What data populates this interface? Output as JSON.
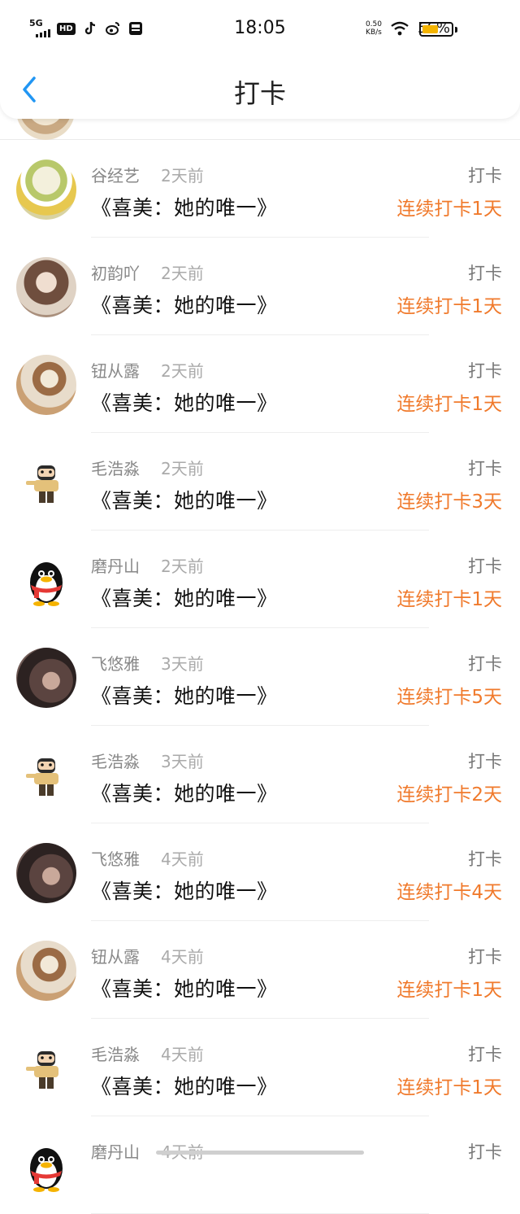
{
  "status_bar": {
    "network": "5G",
    "hd": "HD",
    "time": "18:05",
    "net_speed_value": "0.50",
    "net_speed_unit": "KB/s",
    "battery": "56%",
    "battery_level": 0.56,
    "icons": [
      "signal-icon",
      "tiktok-icon",
      "weibo-icon",
      "app-icon",
      "wifi-icon",
      "battery-icon"
    ]
  },
  "nav": {
    "title": "打卡",
    "back_icon": "chevron-left-icon"
  },
  "colors": {
    "accent_blue": "#2196f3",
    "streak_orange": "#f07a2c"
  },
  "items": [
    {
      "name": "谷经艺",
      "time": "2天前",
      "action": "打卡",
      "book": "《喜美：她的唯一》",
      "streak": "连续打卡1天",
      "avatar": "cupcake"
    },
    {
      "name": "初韵吖",
      "time": "2天前",
      "action": "打卡",
      "book": "《喜美：她的唯一》",
      "streak": "连续打卡1天",
      "avatar": "girl"
    },
    {
      "name": "钮从露",
      "time": "2天前",
      "action": "打卡",
      "book": "《喜美：她的唯一》",
      "streak": "连续打卡1天",
      "avatar": "warrior"
    },
    {
      "name": "毛浩淼",
      "time": "2天前",
      "action": "打卡",
      "book": "《喜美：她的唯一》",
      "streak": "连续打卡3天",
      "avatar": "cartoon"
    },
    {
      "name": "磨丹山",
      "time": "2天前",
      "action": "打卡",
      "book": "《喜美：她的唯一》",
      "streak": "连续打卡1天",
      "avatar": "penguin"
    },
    {
      "name": "飞悠雅",
      "time": "3天前",
      "action": "打卡",
      "book": "《喜美：她的唯一》",
      "streak": "连续打卡5天",
      "avatar": "dark"
    },
    {
      "name": "毛浩淼",
      "time": "3天前",
      "action": "打卡",
      "book": "《喜美：她的唯一》",
      "streak": "连续打卡2天",
      "avatar": "cartoon"
    },
    {
      "name": "飞悠雅",
      "time": "4天前",
      "action": "打卡",
      "book": "《喜美：她的唯一》",
      "streak": "连续打卡4天",
      "avatar": "dark"
    },
    {
      "name": "钮从露",
      "time": "4天前",
      "action": "打卡",
      "book": "《喜美：她的唯一》",
      "streak": "连续打卡1天",
      "avatar": "warrior"
    },
    {
      "name": "毛浩淼",
      "time": "4天前",
      "action": "打卡",
      "book": "《喜美：她的唯一》",
      "streak": "连续打卡1天",
      "avatar": "cartoon"
    },
    {
      "name": "磨丹山",
      "time": "4天前",
      "action": "打卡",
      "book": "",
      "streak": "",
      "avatar": "penguin"
    }
  ]
}
